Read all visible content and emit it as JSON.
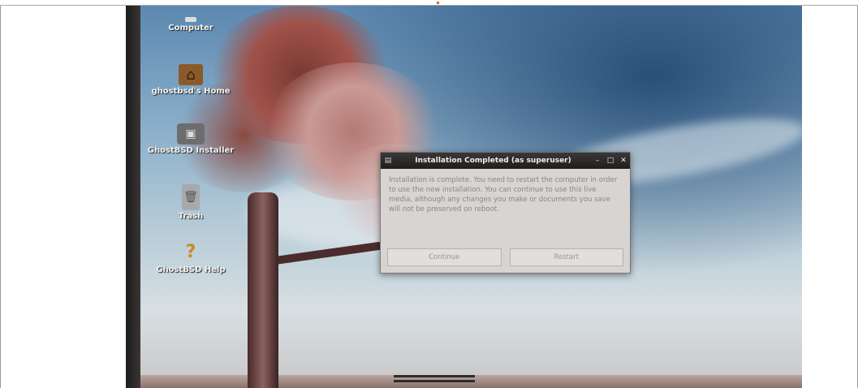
{
  "desktop": {
    "icons": [
      {
        "label": "Computer"
      },
      {
        "label": "ghostbsd's Home"
      },
      {
        "label": "GhostBSD Installer"
      },
      {
        "label": "Trash"
      },
      {
        "label": "GhostBSD Help"
      }
    ],
    "icon_glyphs": {
      "home": "⌂",
      "installer": "▣",
      "trash": "🗑",
      "help": "?"
    }
  },
  "dialog": {
    "title": "Installation Completed (as superuser)",
    "menu_glyph": "▤",
    "minimize_glyph": "–",
    "maximize_glyph": "□",
    "close_glyph": "✕",
    "message": "Installation is complete. You need to restart the computer in order to use the new installation. You can continue to use this live media, although any changes you make or documents you save will not be preserved on reboot.",
    "buttons": {
      "continue": "Continue",
      "restart": "Restart"
    }
  },
  "colors": {
    "titlebar": "#2a2828",
    "dialog_bg": "#d8d4d2",
    "sky": "#8fb2cc"
  }
}
